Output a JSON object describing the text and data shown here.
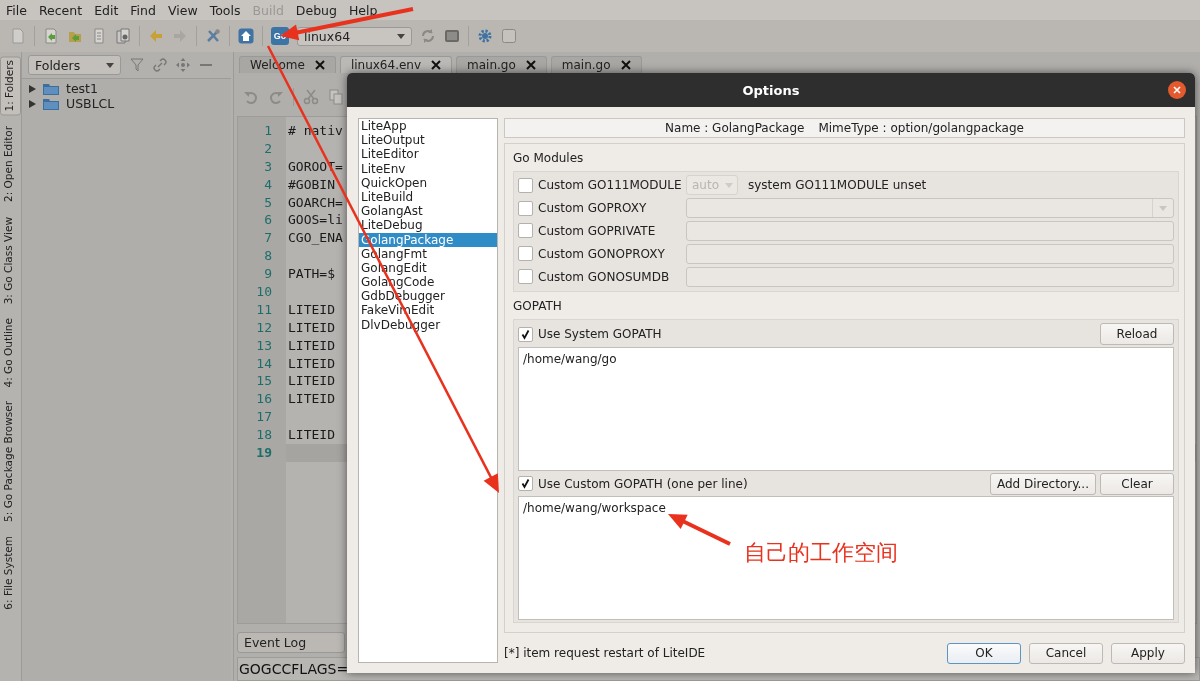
{
  "menu": [
    {
      "label": "File",
      "disabled": false
    },
    {
      "label": "Recent",
      "disabled": false
    },
    {
      "label": "Edit",
      "disabled": false
    },
    {
      "label": "Find",
      "disabled": false
    },
    {
      "label": "View",
      "disabled": false
    },
    {
      "label": "Tools",
      "disabled": false
    },
    {
      "label": "Build",
      "disabled": true
    },
    {
      "label": "Debug",
      "disabled": false
    },
    {
      "label": "Help",
      "disabled": false
    }
  ],
  "toolbar": {
    "go_label": "Go",
    "environment": "linux64"
  },
  "side_tabs": [
    {
      "label": "1: Folders",
      "selected": true
    },
    {
      "label": "2: Open Editor",
      "selected": false
    },
    {
      "label": "3: Go Class View",
      "selected": false
    },
    {
      "label": "4: Go Outline",
      "selected": false
    },
    {
      "label": "5: Go Package Browser",
      "selected": false
    },
    {
      "label": "6: File System",
      "selected": false
    }
  ],
  "folders": {
    "view": "Folders",
    "items": [
      {
        "label": "test1",
        "expanded": false
      },
      {
        "label": "USBLCL",
        "expanded": false
      }
    ]
  },
  "editor": {
    "tabs": [
      {
        "label": "Welcome",
        "selected": false
      },
      {
        "label": "linux64.env",
        "selected": true
      },
      {
        "label": "main.go",
        "selected": false
      },
      {
        "label": "main.go",
        "selected": false
      }
    ],
    "lines": [
      {
        "number": "1",
        "text": "# nativ",
        "current": false
      },
      {
        "number": "2",
        "current": false
      },
      {
        "number": "3",
        "text": "GOROOT=",
        "current": false
      },
      {
        "number": "4",
        "text": "#GOBIN",
        "current": false
      },
      {
        "number": "5",
        "text": "GOARCH=",
        "current": false
      },
      {
        "number": "6",
        "text": "GOOS=li",
        "current": false
      },
      {
        "number": "7",
        "text": "CGO_ENA",
        "current": false
      },
      {
        "number": "8",
        "current": false
      },
      {
        "number": "9",
        "text": "PATH=$",
        "current": false
      },
      {
        "number": "10",
        "current": false
      },
      {
        "number": "11",
        "text": "LITEID",
        "current": false
      },
      {
        "number": "12",
        "text": "LITEID",
        "current": false
      },
      {
        "number": "13",
        "text": "LITEID",
        "current": false
      },
      {
        "number": "14",
        "text": "LITEID",
        "current": false
      },
      {
        "number": "15",
        "text": "LITEID",
        "current": false
      },
      {
        "number": "16",
        "text": "LITEID",
        "current": false
      },
      {
        "number": "17",
        "current": false
      },
      {
        "number": "18",
        "text": "LITEID",
        "current": false
      },
      {
        "number": "19",
        "current": true
      }
    ]
  },
  "event_log": {
    "view": "Event Log",
    "output": "GOGCCFLAGS="
  },
  "dialog": {
    "title": "Options",
    "categories": [
      {
        "label": "LiteApp",
        "selected": false
      },
      {
        "label": "LiteOutput",
        "selected": false
      },
      {
        "label": "LiteEditor",
        "selected": false
      },
      {
        "label": "LiteEnv",
        "selected": false
      },
      {
        "label": "QuickOpen",
        "selected": false
      },
      {
        "label": "LiteBuild",
        "selected": false
      },
      {
        "label": "GolangAst",
        "selected": false
      },
      {
        "label": "LiteDebug",
        "selected": false
      },
      {
        "label": "GolangPackage",
        "selected": true
      },
      {
        "label": "GolangFmt",
        "selected": false
      },
      {
        "label": "GolangEdit",
        "selected": false
      },
      {
        "label": "GolangCode",
        "selected": false
      },
      {
        "label": "GdbDebugger",
        "selected": false
      },
      {
        "label": "FakeVimEdit",
        "selected": false
      },
      {
        "label": "DlvDebugger",
        "selected": false
      }
    ],
    "header": {
      "name": "Name : GolangPackage",
      "mime_type": "MimeType : option/golangpackage"
    },
    "go_modules": {
      "title": "Go Modules",
      "options": [
        {
          "kind": "select",
          "label": "Custom GO111MODULE",
          "checked": false,
          "value": "auto",
          "note": "system GO111MODULE unset"
        },
        {
          "kind": "combo",
          "label": "Custom GOPROXY",
          "checked": false
        },
        {
          "kind": "field",
          "label": "Custom GOPRIVATE",
          "checked": false
        },
        {
          "kind": "field",
          "label": "Custom GONOPROXY",
          "checked": false
        },
        {
          "kind": "field",
          "label": "Custom GONOSUMDB",
          "checked": false
        }
      ]
    },
    "gopath": {
      "title": "GOPATH",
      "system": {
        "label": "Use System GOPATH",
        "checked": true,
        "buttons": [
          "Reload"
        ],
        "paths": "/home/wang/go"
      },
      "custom": {
        "label": "Use Custom GOPATH (one per line)",
        "checked": true,
        "buttons": [
          "Add Directory...",
          "Clear"
        ],
        "paths": "/home/wang/workspace"
      }
    },
    "footnote": "[*] item request restart of LiteIDE",
    "buttons": [
      {
        "label": "OK",
        "default": true
      },
      {
        "label": "Cancel",
        "default": false
      },
      {
        "label": "Apply",
        "default": false
      }
    ]
  },
  "annotation": {
    "text": "自己的工作空间"
  }
}
